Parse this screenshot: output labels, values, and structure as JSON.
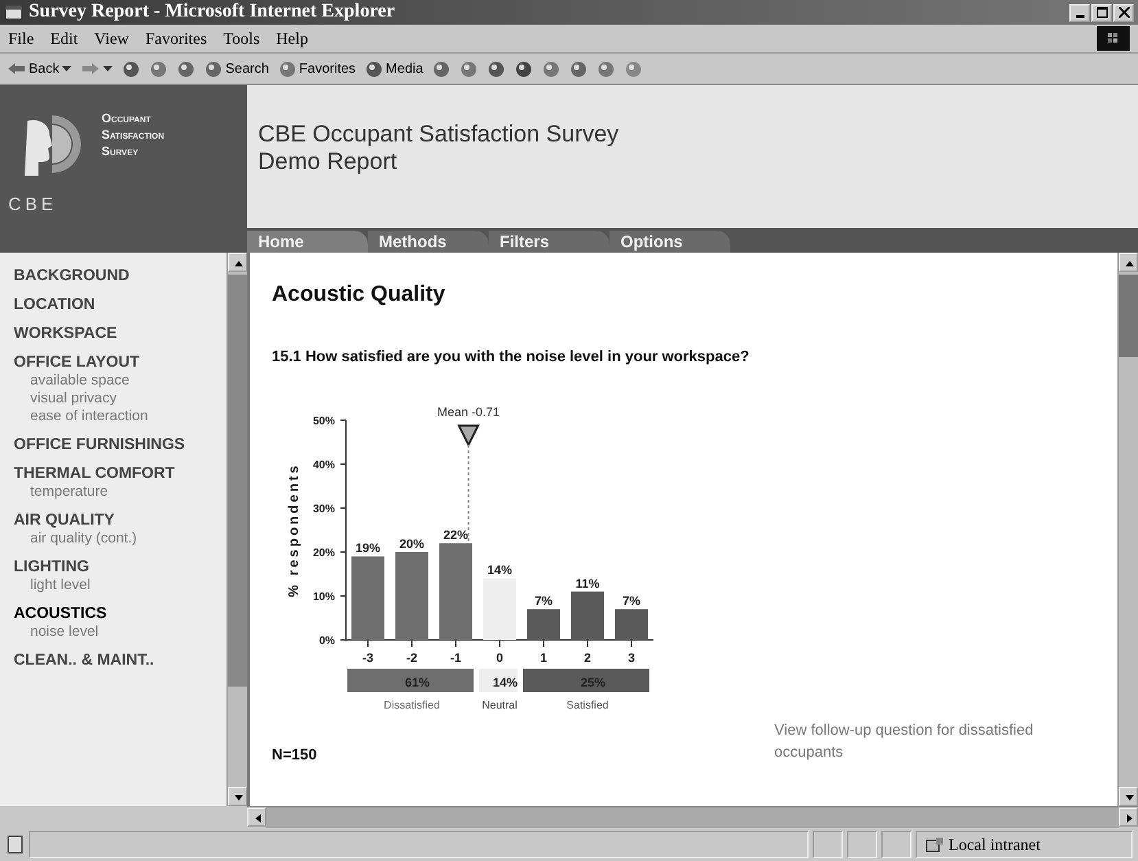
{
  "window": {
    "title": "Survey Report - Microsoft Internet Explorer"
  },
  "menu": [
    "File",
    "Edit",
    "View",
    "Favorites",
    "Tools",
    "Help"
  ],
  "toolbar": [
    {
      "kind": "back",
      "label": "Back"
    },
    {
      "kind": "forward"
    },
    {
      "kind": "stop"
    },
    {
      "kind": "refresh"
    },
    {
      "kind": "home"
    },
    {
      "kind": "search",
      "label": "Search"
    },
    {
      "kind": "favorites",
      "label": "Favorites"
    },
    {
      "kind": "media",
      "label": "Media"
    },
    {
      "kind": "history"
    },
    {
      "kind": "mail"
    },
    {
      "kind": "print"
    },
    {
      "kind": "edit"
    },
    {
      "kind": "discuss"
    },
    {
      "kind": "messenger"
    },
    {
      "kind": "research"
    },
    {
      "kind": "chat"
    }
  ],
  "logo": {
    "lines": [
      "Occupant",
      "Satisfaction",
      "Survey"
    ],
    "mark": "CBE"
  },
  "header": {
    "title_lines": [
      "CBE Occupant Satisfaction Survey",
      "Demo Report"
    ]
  },
  "tabs": [
    {
      "label": "Home",
      "selected": true
    },
    {
      "label": "Methods",
      "selected": false
    },
    {
      "label": "Filters",
      "selected": false
    },
    {
      "label": "Options",
      "selected": false
    }
  ],
  "sidebar": {
    "items": [
      {
        "label": "BACKGROUND",
        "selected": false
      },
      {
        "label": "LOCATION",
        "selected": false
      },
      {
        "label": "WORKSPACE",
        "selected": false
      },
      {
        "label": "OFFICE LAYOUT",
        "selected": false,
        "children": [
          "available space",
          "visual privacy",
          "ease of interaction"
        ]
      },
      {
        "label": "OFFICE FURNISHINGS",
        "selected": false
      },
      {
        "label": "THERMAL COMFORT",
        "selected": false,
        "children": [
          "temperature"
        ]
      },
      {
        "label": "AIR QUALITY",
        "selected": false,
        "children": [
          "air quality (cont.)"
        ]
      },
      {
        "label": "LIGHTING",
        "selected": false,
        "children": [
          "light level"
        ]
      },
      {
        "label": "ACOUSTICS",
        "selected": true,
        "children": [
          "noise level"
        ]
      },
      {
        "label": "CLEAN.. & MAINT..",
        "selected": false
      }
    ]
  },
  "content": {
    "heading": "Acoustic Quality",
    "question": "15.1 How satisfied are you with the noise level in your workspace?",
    "chart_data": {
      "type": "bar",
      "ylabel": "% respondents",
      "x": [
        -3,
        -2,
        -1,
        0,
        1,
        2,
        3
      ],
      "xticks": [
        -3,
        -2,
        -1,
        0,
        1,
        2,
        3
      ],
      "series": [
        {
          "name": "Dissatisfied",
          "color": "#6e6e6e",
          "values": [
            19,
            20,
            22,
            null,
            null,
            null,
            null
          ]
        },
        {
          "name": "Neutral",
          "color": "#eeeeee",
          "values": [
            null,
            null,
            null,
            14,
            null,
            null,
            null
          ]
        },
        {
          "name": "Satisfied",
          "color": "#5a5a5a",
          "values": [
            null,
            null,
            null,
            null,
            7,
            11,
            7
          ]
        }
      ],
      "xlim": [
        -3.5,
        3.5
      ],
      "ylim": [
        0,
        50
      ],
      "yticks": [
        {
          "value": 0,
          "label": "0%"
        },
        {
          "value": 10,
          "label": "10%"
        },
        {
          "value": 20,
          "label": "20%"
        },
        {
          "value": 30,
          "label": "30%"
        },
        {
          "value": 40,
          "label": "40%"
        },
        {
          "value": 50,
          "label": "50%"
        }
      ],
      "value_labels": [
        "19%",
        "20%",
        "22%",
        "14%",
        "7%",
        "11%",
        "7%"
      ],
      "ref_lines": [
        {
          "axis": "x",
          "value": -0.71,
          "label": "Mean -0.71"
        }
      ]
    },
    "summary": [
      "61%",
      "14%",
      "25%"
    ],
    "n": "N=150",
    "link": "View follow-up question for dissatisfied occupants"
  },
  "status_bar": {
    "zone": "Local intranet"
  }
}
